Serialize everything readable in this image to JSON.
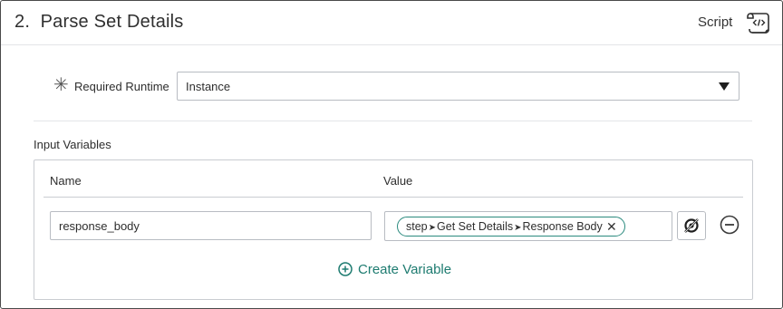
{
  "step": {
    "title": "2.  Parse Set Details",
    "type_label": "Script",
    "icon": "scroll-code-icon"
  },
  "runtime": {
    "label": "Required Runtime",
    "value": "Instance",
    "required_icon": "asterisk-icon"
  },
  "input_variables": {
    "section_label": "Input Variables",
    "columns": {
      "name": "Name",
      "value": "Value"
    },
    "rows": [
      {
        "name": "response_body",
        "value_pill": {
          "segments": [
            "step",
            "Get Set Details",
            "Response Body"
          ]
        }
      }
    ],
    "create_label": "Create Variable"
  },
  "colors": {
    "accent": "#1d7b70",
    "pill_border": "#2b8a7e",
    "border": "#b8bcc2"
  }
}
